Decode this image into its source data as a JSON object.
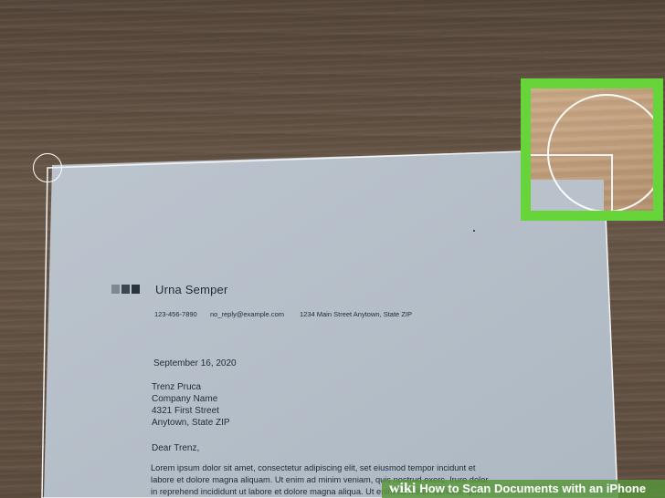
{
  "letter": {
    "sender_name": "Urna Semper",
    "phone": "123-456-7890",
    "email": "no_reply@example.com",
    "address": "1234 Main Street   Anytown, State  ZIP",
    "date": "September 16, 2020",
    "recipient_lines": [
      "Trenz Pruca",
      "Company Name",
      "4321 First Street",
      "Anytown, State ZIP"
    ],
    "greeting": "Dear Trenz,",
    "body_lines": [
      "Lorem ipsum dolor sit amet, consectetur adipiscing elit, set eiusmod tempor incidunt et",
      "labore et dolore magna aliquam. Ut enim ad minim veniam, quis nostrud exerc. Irure dolor",
      "in reprehend incididunt ut labore et dolore magna aliqua. Ut enim ad minim veniam, quis"
    ],
    "logo_colors": [
      "#7d8891",
      "#3c4650",
      "#2a323a"
    ]
  },
  "watermark": {
    "brand": "wiki",
    "title": "How to Scan Documents with an iPhone"
  },
  "colors": {
    "crop_border": "#67d43a",
    "paper": "#b7c0c9"
  }
}
